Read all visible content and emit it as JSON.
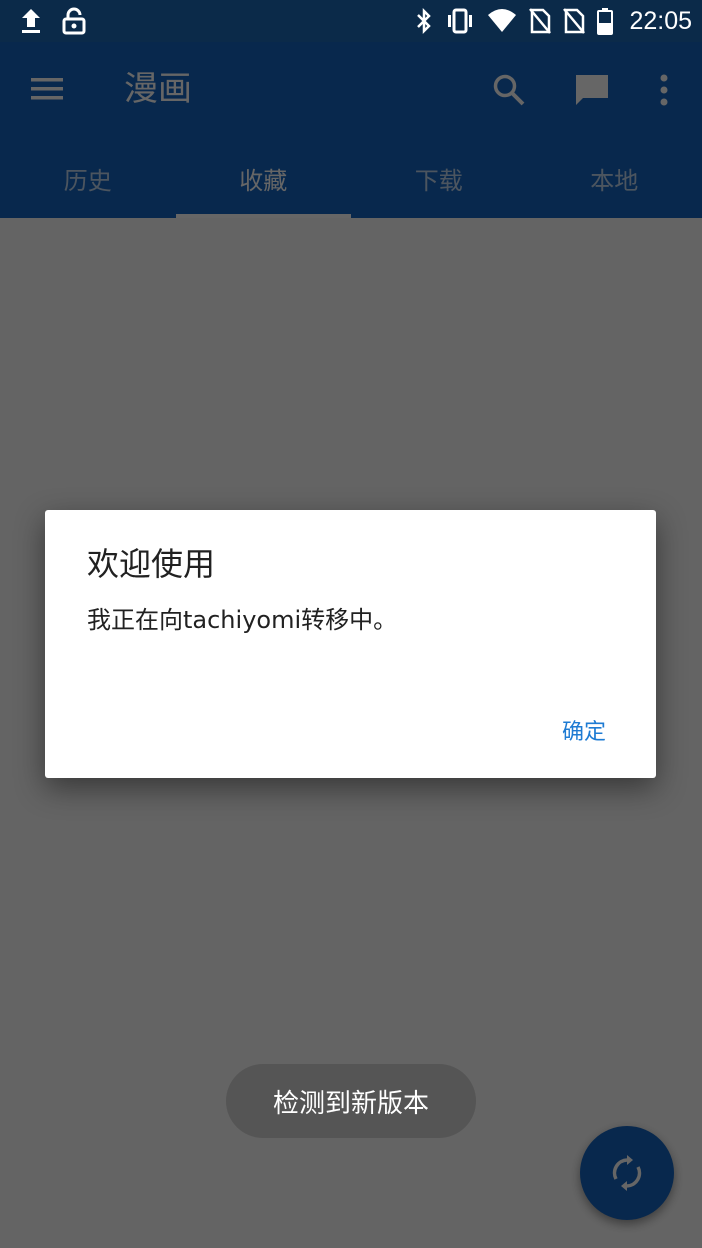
{
  "status_bar": {
    "time": "22:05",
    "left_icons": [
      "upload-icon",
      "lock-open-icon"
    ],
    "right_icons": [
      "bluetooth-icon",
      "vibrate-icon",
      "wifi-icon",
      "no-sim-icon",
      "no-sim-icon",
      "battery-icon"
    ]
  },
  "app_bar": {
    "title": "漫画",
    "actions": [
      "search-icon",
      "message-icon",
      "more-vert-icon"
    ],
    "color": "#1565c0"
  },
  "tabs": [
    {
      "label": "历史",
      "active": false
    },
    {
      "label": "收藏",
      "active": true
    },
    {
      "label": "下载",
      "active": false
    },
    {
      "label": "本地",
      "active": false
    }
  ],
  "dialog": {
    "title": "欢迎使用",
    "message": "我正在向tachiyomi转移中。",
    "confirm_label": "确定",
    "accent": "#1e7bd3"
  },
  "toast": {
    "text": "检测到新版本"
  },
  "fab": {
    "icon": "sync-icon"
  }
}
